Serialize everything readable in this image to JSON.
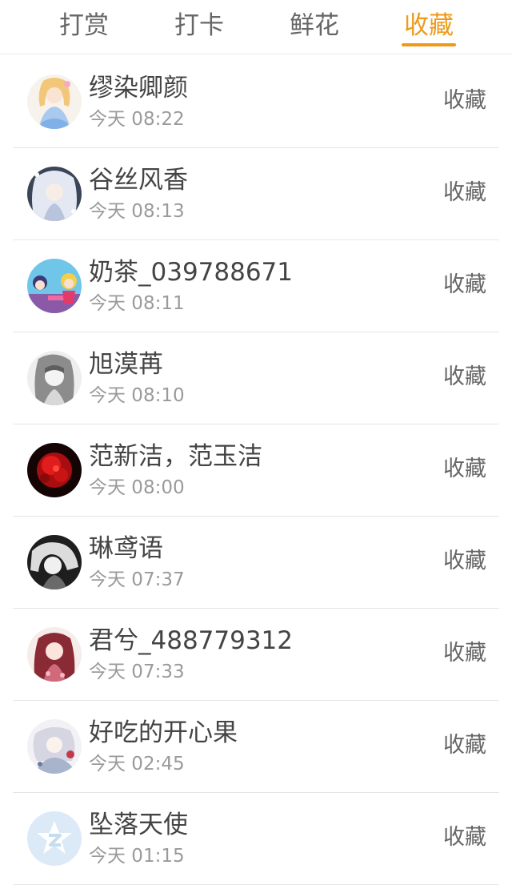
{
  "tabs": [
    {
      "label": "打赏",
      "active": false
    },
    {
      "label": "打卡",
      "active": false
    },
    {
      "label": "鲜花",
      "active": false
    },
    {
      "label": "收藏",
      "active": true
    }
  ],
  "colors": {
    "accent": "#ee9a1a",
    "text_primary": "#444444",
    "text_secondary": "#9a9a9a",
    "divider": "#e6e6e6"
  },
  "items": [
    {
      "name": "缪染卿颜",
      "time": "今天 08:22",
      "tag": "收藏",
      "avatar": "anime-girl-blonde-avatar"
    },
    {
      "name": "谷丝风香",
      "time": "今天 08:13",
      "tag": "收藏",
      "avatar": "anime-girl-white-hair-avatar"
    },
    {
      "name": "奶茶_039788671",
      "time": "今天 08:11",
      "tag": "收藏",
      "avatar": "anime-girls-group-avatar"
    },
    {
      "name": "旭漠苒",
      "time": "今天 08:10",
      "tag": "收藏",
      "avatar": "sketch-girl-avatar"
    },
    {
      "name": "范新洁，范玉洁",
      "time": "今天 08:00",
      "tag": "收藏",
      "avatar": "red-flower-avatar"
    },
    {
      "name": "琳鸢语",
      "time": "今天 07:37",
      "tag": "收藏",
      "avatar": "monochrome-girl-avatar"
    },
    {
      "name": "君兮_488779312",
      "time": "今天 07:33",
      "tag": "收藏",
      "avatar": "red-hair-girl-avatar"
    },
    {
      "name": "好吃的开心果",
      "time": "今天 02:45",
      "tag": "收藏",
      "avatar": "anime-girl-pale-avatar"
    },
    {
      "name": "坠落天使",
      "time": "今天 01:15",
      "tag": "收藏",
      "avatar": "default-qq-avatar"
    }
  ]
}
